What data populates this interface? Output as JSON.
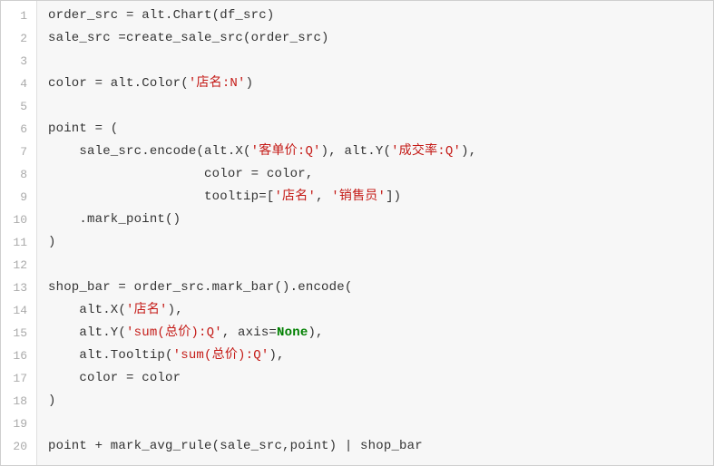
{
  "code": {
    "lines": [
      [
        {
          "cls": "tok-plain",
          "t": "order_src = alt.Chart(df_src)"
        }
      ],
      [
        {
          "cls": "tok-plain",
          "t": "sale_src =create_sale_src(order_src)"
        }
      ],
      [
        {
          "cls": "tok-plain",
          "t": ""
        }
      ],
      [
        {
          "cls": "tok-plain",
          "t": "color = alt.Color("
        },
        {
          "cls": "tok-str",
          "t": "'店名:N'"
        },
        {
          "cls": "tok-plain",
          "t": ")"
        }
      ],
      [
        {
          "cls": "tok-plain",
          "t": ""
        }
      ],
      [
        {
          "cls": "tok-plain",
          "t": "point = ("
        }
      ],
      [
        {
          "cls": "tok-plain",
          "t": "    sale_src.encode(alt.X("
        },
        {
          "cls": "tok-str",
          "t": "'客单价:Q'"
        },
        {
          "cls": "tok-plain",
          "t": "), alt.Y("
        },
        {
          "cls": "tok-str",
          "t": "'成交率:Q'"
        },
        {
          "cls": "tok-plain",
          "t": "),"
        }
      ],
      [
        {
          "cls": "tok-plain",
          "t": "                    color = color,"
        }
      ],
      [
        {
          "cls": "tok-plain",
          "t": "                    tooltip=["
        },
        {
          "cls": "tok-str",
          "t": "'店名'"
        },
        {
          "cls": "tok-plain",
          "t": ", "
        },
        {
          "cls": "tok-str",
          "t": "'销售员'"
        },
        {
          "cls": "tok-plain",
          "t": "])"
        }
      ],
      [
        {
          "cls": "tok-plain",
          "t": "    .mark_point()"
        }
      ],
      [
        {
          "cls": "tok-plain",
          "t": ")"
        }
      ],
      [
        {
          "cls": "tok-plain",
          "t": ""
        }
      ],
      [
        {
          "cls": "tok-plain",
          "t": "shop_bar = order_src.mark_bar().encode("
        }
      ],
      [
        {
          "cls": "tok-plain",
          "t": "    alt.X("
        },
        {
          "cls": "tok-str",
          "t": "'店名'"
        },
        {
          "cls": "tok-plain",
          "t": "),"
        }
      ],
      [
        {
          "cls": "tok-plain",
          "t": "    alt.Y("
        },
        {
          "cls": "tok-str",
          "t": "'sum(总价):Q'"
        },
        {
          "cls": "tok-plain",
          "t": ", axis="
        },
        {
          "cls": "tok-kw",
          "t": "None"
        },
        {
          "cls": "tok-plain",
          "t": "),"
        }
      ],
      [
        {
          "cls": "tok-plain",
          "t": "    alt.Tooltip("
        },
        {
          "cls": "tok-str",
          "t": "'sum(总价):Q'"
        },
        {
          "cls": "tok-plain",
          "t": "),"
        }
      ],
      [
        {
          "cls": "tok-plain",
          "t": "    color = color"
        }
      ],
      [
        {
          "cls": "tok-plain",
          "t": ")"
        }
      ],
      [
        {
          "cls": "tok-plain",
          "t": ""
        }
      ],
      [
        {
          "cls": "tok-plain",
          "t": "point + mark_avg_rule(sale_src,point) | shop_bar"
        }
      ]
    ]
  }
}
